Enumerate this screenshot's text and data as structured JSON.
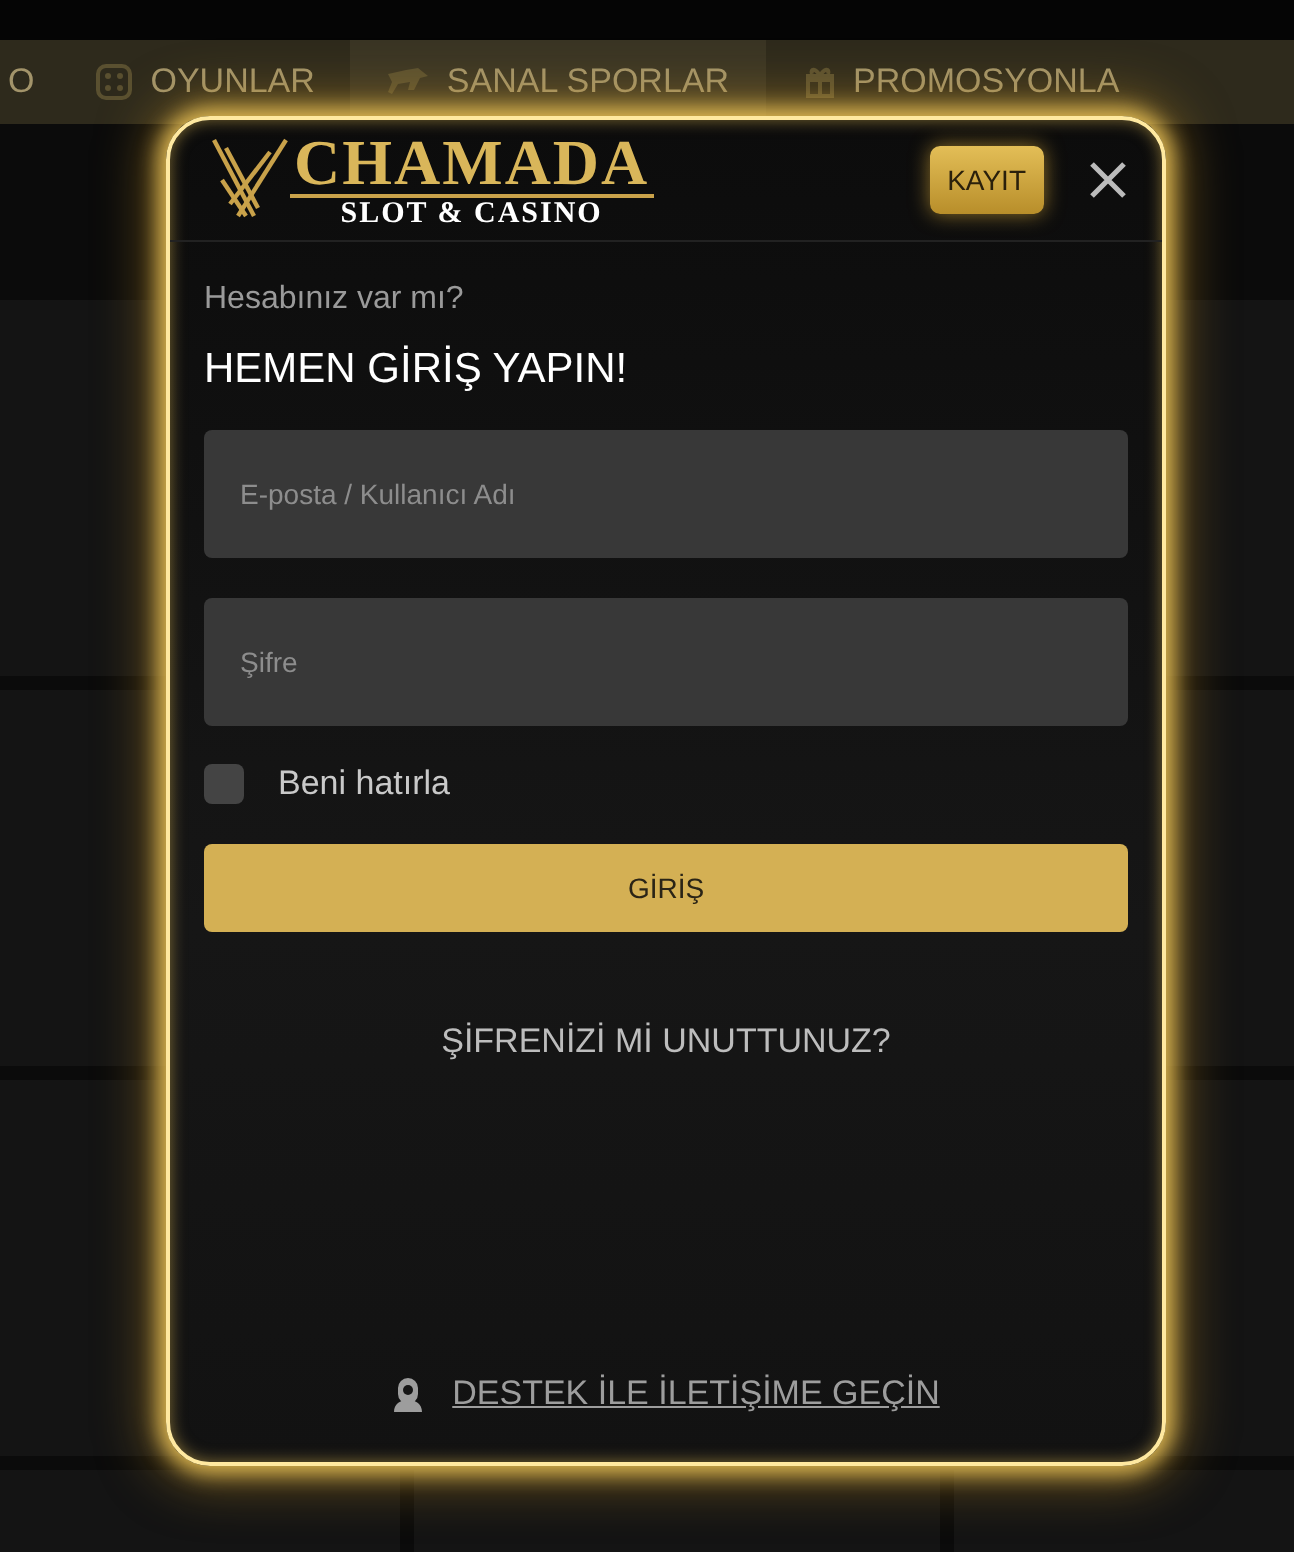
{
  "nav": {
    "items": [
      {
        "label": "O",
        "selected": false
      },
      {
        "label": "OYUNLAR",
        "selected": false
      },
      {
        "label": "SANAL SPORLAR",
        "selected": true
      },
      {
        "label": "PROMOSYONLA",
        "selected": false
      }
    ]
  },
  "modal": {
    "logo": {
      "title": "CHAMADA",
      "subtitle": "SLOT & CASINO"
    },
    "register_button": "KAYIT",
    "prompt": "Hesabınız var mı?",
    "heading": "HEMEN GİRİŞ YAPIN!",
    "fields": [
      {
        "placeholder": "E-posta / Kullanıcı Adı"
      },
      {
        "placeholder": "Şifre"
      }
    ],
    "remember": {
      "label": "Beni hatırla",
      "checked": false
    },
    "submit_button": "GİRİŞ",
    "forgot_link": "ŞİFRENİZİ Mİ UNUTTUNUZ?",
    "support_link": "DESTEK İLE İLETİŞİME GEÇİN"
  }
}
